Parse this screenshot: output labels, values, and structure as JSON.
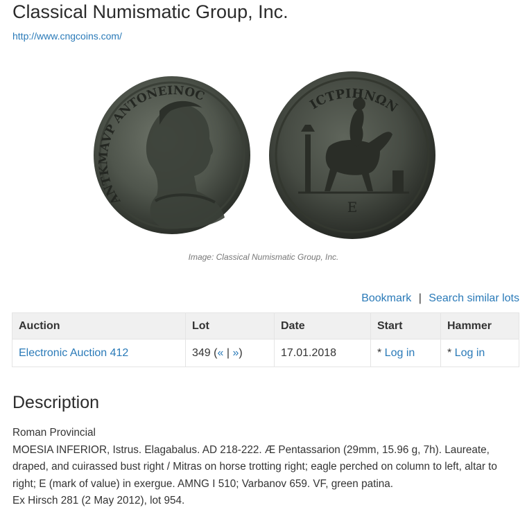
{
  "header": {
    "title": "Classical Numismatic Group, Inc.",
    "url": "http://www.cngcoins.com/"
  },
  "image": {
    "caption": "Image: Classical Numismatic Group, Inc.",
    "obverse_legend": "ANTKMAVP ANTONEINOC",
    "reverse_legend": "ICTPIHNΩN",
    "exergue": "E"
  },
  "actions": {
    "bookmark": "Bookmark",
    "separator": "|",
    "search_similar": "Search similar lots"
  },
  "table": {
    "headers": [
      "Auction",
      "Lot",
      "Date",
      "Start",
      "Hammer"
    ],
    "row": {
      "auction": "Electronic Auction 412",
      "lot_number": "349",
      "lot_open": "(",
      "prev": "«",
      "nav_sep": "|",
      "next": "»",
      "lot_close": ")",
      "date": "17.01.2018",
      "start_prefix": "* ",
      "start_link": "Log in",
      "hammer_prefix": "* ",
      "hammer_link": "Log in"
    }
  },
  "description": {
    "heading": "Description",
    "category": "Roman Provincial",
    "text": "MOESIA INFERIOR, Istrus. Elagabalus. AD 218-222. Æ Pentassarion (29mm, 15.96 g, 7h). Laureate, draped, and cuirassed bust right / Mitras on horse trotting right; eagle perched on column to left, altar to right; E (mark of value) in exergue. AMNG I 510; Varbanov 659. VF, green patina.",
    "provenance": "Ex Hirsch 281 (2 May 2012), lot 954."
  }
}
